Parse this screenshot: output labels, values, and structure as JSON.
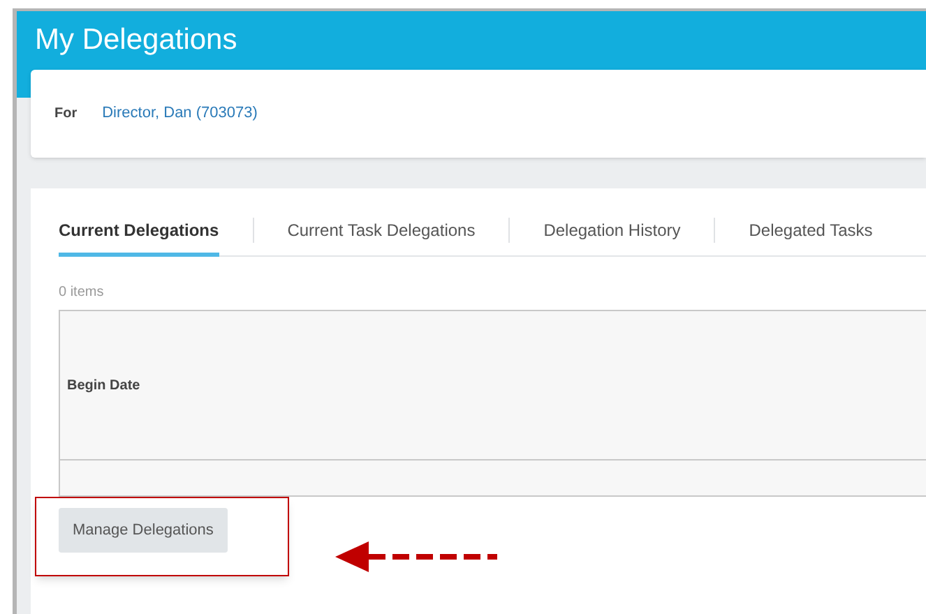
{
  "header": {
    "title": "My Delegations"
  },
  "for_field": {
    "label": "For",
    "value": "Director, Dan (703073)"
  },
  "tabs": [
    {
      "label": "Current Delegations",
      "selected": true
    },
    {
      "label": "Current Task Delegations",
      "selected": false
    },
    {
      "label": "Delegation History",
      "selected": false
    },
    {
      "label": "Delegated Tasks",
      "selected": false
    }
  ],
  "item_count": "0 items",
  "table": {
    "columns": [
      "Begin Date"
    ]
  },
  "buttons": [
    "Manage Delegations"
  ]
}
